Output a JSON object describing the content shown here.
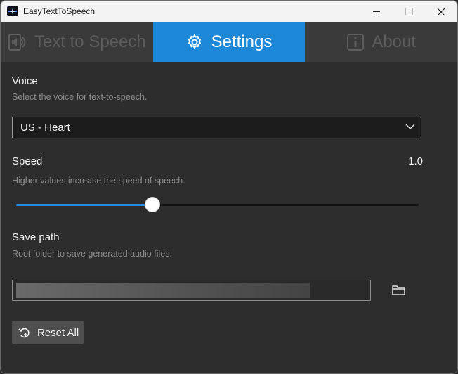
{
  "window": {
    "title": "EasyTextToSpeech"
  },
  "tabs": [
    {
      "label": "Text to Speech",
      "icon": "speaker-document-icon",
      "active": false
    },
    {
      "label": "Settings",
      "icon": "gear-icon",
      "active": true
    },
    {
      "label": "About",
      "icon": "info-icon",
      "active": false
    }
  ],
  "settings": {
    "voice": {
      "label": "Voice",
      "description": "Select the voice for text-to-speech.",
      "selected": "US - Heart"
    },
    "speed": {
      "label": "Speed",
      "description": "Higher values increase the speed of speech.",
      "value_text": "1.0",
      "slider_fraction": 0.338
    },
    "save_path": {
      "label": "Save path",
      "description": "Root folder to save generated audio files.",
      "value": ""
    },
    "reset_label": "Reset All"
  },
  "colors": {
    "accent": "#1e88d8",
    "background": "#2d2d2d",
    "tabbar": "#3a3a3a"
  }
}
